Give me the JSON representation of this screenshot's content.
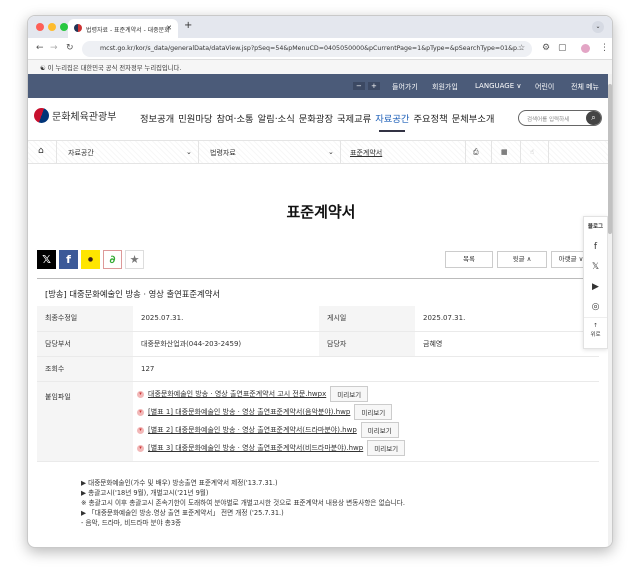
{
  "browser": {
    "tab_title": "법령자료 - 표준계약서 - 대중문화",
    "url": "mcst.go.kr/kor/s_data/generalData/dataView.jsp?pSeq=54&pMenuCD=0405050000&pCurrentPage=1&pType=&pSearchType=01&p..."
  },
  "notice": "이 누리집은 대한민국 공식 전자정부 누리집입니다.",
  "topbar": {
    "minus": "−",
    "plus": "+",
    "login": "들어가기",
    "join": "회원가입",
    "language": "LANGUAGE ∨",
    "kids": "어린이",
    "allmenu": "전체 메뉴"
  },
  "header": {
    "logo": "문화체육관광부",
    "gnb": [
      "정보공개",
      "민원마당",
      "참여·소통",
      "알림·소식",
      "문화광장",
      "국제교류",
      "자료공간",
      "주요정책",
      "문체부소개"
    ],
    "search_placeholder": "검색어를 입력하세"
  },
  "subnav": {
    "level1": "자료공간",
    "level2": "법령자료",
    "level3": "표준계약서"
  },
  "page_title": "표준계약서",
  "buttons": {
    "list": "목록",
    "next": "윗글 ∧",
    "prev": "아랫글 ∨"
  },
  "doc": {
    "title": "[방송] 대중문화예술인 방송 · 영상 출연표준계약서",
    "rows": [
      {
        "k1": "최종수정일",
        "v1": "2025.07.31.",
        "k2": "게시일",
        "v2": "2025.07.31."
      },
      {
        "k1": "담당부서",
        "v1": "대중문화산업과(044-203-2459)",
        "k2": "담당자",
        "v2": "금혜영"
      }
    ],
    "views_label": "조회수",
    "views": "127",
    "files_label": "붙임파일",
    "files": [
      "대중문화예술인 방송 · 영상 출연표준계약서 고시 전문.hwpx",
      "[별표 1] 대중문화예술인 방송 · 영상 출연표준계약서(음악분야).hwp",
      "[별표 2] 대중문화예술인 방송 · 영상 출연표준계약서(드라마분야).hwp",
      "[별표 3] 대중문화예술인 방송 · 영상 출연표준계약서(비드라마분야).hwp"
    ],
    "preview": "미리보기"
  },
  "notes": [
    "▶ 대중문화예술인(가수 및 배우) 방송출연 표준계약서 제정('13.7.31.)",
    "▶ 총괄고시('18년 9월), 개별고시('21년 9월)",
    "※ 총괄고시 이후 총괄고시 존속기한이 도래하여 분야별로 개별고시한 것으로 표준계약서 내용상 변동사항은 없습니다.",
    "▶ 「대중문화예술인 방송.영상 출연 표준계약서」 전면 개정 ('25.7.31.)",
    "- 음악, 드라마, 비드라마 분야 총3종"
  ],
  "float": {
    "label": "블로그",
    "top": "위로"
  },
  "colors": {
    "topbar": "#4b5b79",
    "active_menu": "#1d5fb8"
  }
}
